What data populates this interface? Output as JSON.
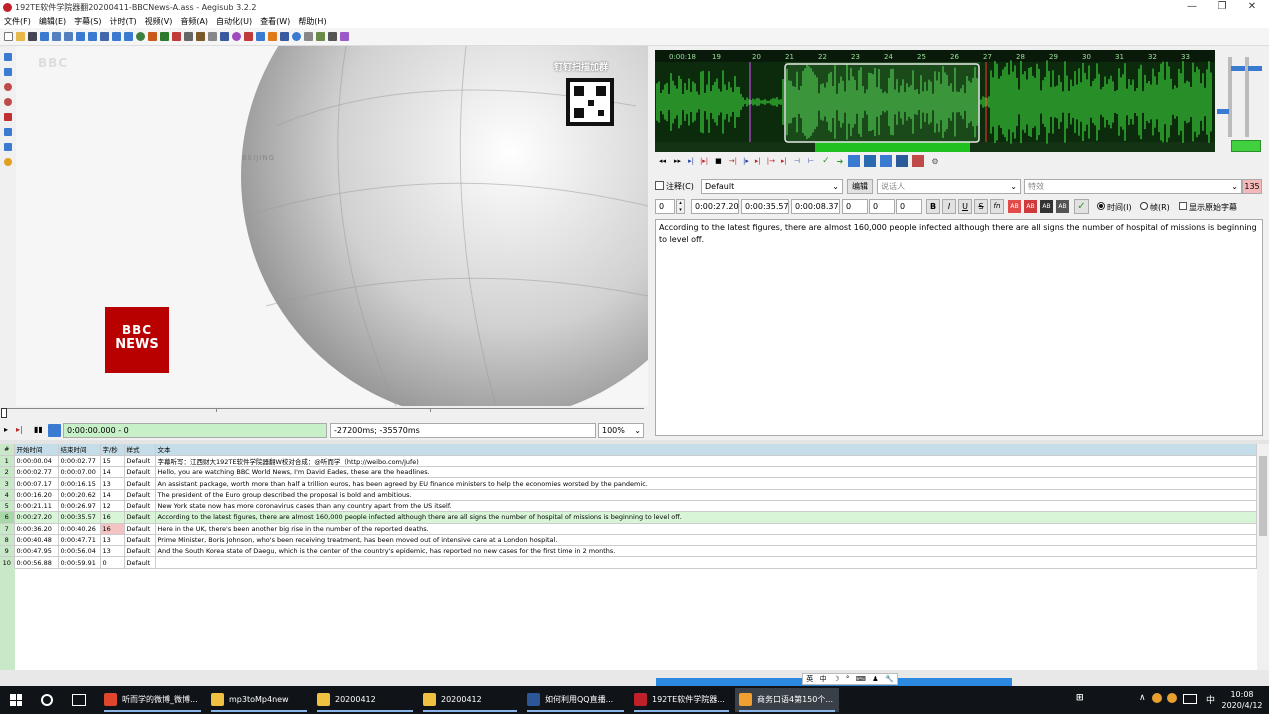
{
  "window": {
    "title": "192TE软件学院器翻20200411-BBCNews-A.ass - Aegisub 3.2.2",
    "min": "—",
    "max": "❐",
    "close": "✕"
  },
  "menu": [
    "文件(F)",
    "编辑(E)",
    "字幕(S)",
    "计时(T)",
    "视频(V)",
    "音频(A)",
    "自动化(U)",
    "查看(W)",
    "帮助(H)"
  ],
  "video": {
    "bbc_logo": "BBC",
    "bbc_news_top": "BBC",
    "bbc_news_bottom": "NEWS",
    "watermark": "钉钉扫描加群",
    "city": "BEIJING",
    "timecode": "0:00:00.000 - 0",
    "offset": "-27200ms; -35570ms",
    "zoom": "100%"
  },
  "audio": {
    "ticks": [
      "0:00:18",
      "19",
      "20",
      "21",
      "22",
      "23",
      "24",
      "25",
      "26",
      "27",
      "28",
      "29",
      "30",
      "31",
      "32",
      "33"
    ]
  },
  "edit": {
    "comment_label": "注释(C)",
    "style": "Default",
    "edit_button": "编辑",
    "actor_placeholder": "说话人",
    "effect_placeholder": "特效",
    "char_count": "135",
    "layer": "0",
    "start": "0:00:27.20",
    "end": "0:00:35.57",
    "duration": "0:00:08.37",
    "margin_l": "0",
    "margin_r": "0",
    "margin_v": "0",
    "bold": "B",
    "italic": "I",
    "underline": "U",
    "strike": "S",
    "fn": "fn",
    "time_radio": "时间(I)",
    "frame_radio": "帧(R)",
    "show_original": "显示原始字幕",
    "text": "According to the latest figures, there are almost 160,000 people infected although there are all signs the number of hospital of missions is beginning to level off."
  },
  "grid": {
    "headers": [
      "#",
      "开始时间",
      "结束时间",
      "字/秒",
      "样式",
      "文本"
    ],
    "rows": [
      {
        "n": "1",
        "start": "0:00:00.04",
        "end": "0:00:02.77",
        "cps": "15",
        "style": "Default",
        "text": "字幕听写：江西财大192TE软件学院器翻W校对合成：@听而学（http://weibo.com/jufe)"
      },
      {
        "n": "2",
        "start": "0:00:02.77",
        "end": "0:00:07.00",
        "cps": "14",
        "style": "Default",
        "text": "Hello, you are watching BBC World News, I'm David Eades, these are the headlines."
      },
      {
        "n": "3",
        "start": "0:00:07.17",
        "end": "0:00:16.15",
        "cps": "13",
        "style": "Default",
        "text": "An assistant package, worth more than half a trillion euros, has been agreed by EU finance ministers to help the economies worsted by the pandemic."
      },
      {
        "n": "4",
        "start": "0:00:16.20",
        "end": "0:00:20.62",
        "cps": "14",
        "style": "Default",
        "text": "The president of the Euro group described the proposal is bold and ambitious."
      },
      {
        "n": "5",
        "start": "0:00:21.11",
        "end": "0:00:26.97",
        "cps": "12",
        "style": "Default",
        "text": "New York state now has more coronavirus cases than any country apart from the US itself."
      },
      {
        "n": "6",
        "start": "0:00:27.20",
        "end": "0:00:35.57",
        "cps": "16",
        "style": "Default",
        "text": "According to the latest figures, there are almost 160,000 people infected although there are all signs the number of hospital of missions is beginning to level off."
      },
      {
        "n": "7",
        "start": "0:00:36.20",
        "end": "0:00:40.26",
        "cps": "16",
        "style": "Default",
        "text": "Here in the UK, there's been another big rise in the number of the reported deaths."
      },
      {
        "n": "8",
        "start": "0:00:40.48",
        "end": "0:00:47.71",
        "cps": "13",
        "style": "Default",
        "text": "Prime Minister, Boris Johnson, who's been receiving treatment, has been moved out of intensive care at a London hospital."
      },
      {
        "n": "9",
        "start": "0:00:47.95",
        "end": "0:00:56.04",
        "cps": "13",
        "style": "Default",
        "text": "And the South Korea state of Daegu, which is the center of the country's epidemic, has reported no new cases for the first time in 2 months."
      },
      {
        "n": "10",
        "start": "0:00:56.88",
        "end": "0:00:59.91",
        "cps": "0",
        "style": "Default",
        "text": ""
      }
    ]
  },
  "ime": [
    "英",
    "中",
    "☽",
    "°",
    "⌨",
    "♟",
    "🔧"
  ],
  "taskbar": {
    "items": [
      {
        "label": "听而学的微博_微博...",
        "color": "#e0452d"
      },
      {
        "label": "mp3toMp4new",
        "color": "#f0c040"
      },
      {
        "label": "20200412",
        "color": "#f0c040"
      },
      {
        "label": "20200412",
        "color": "#f0c040"
      },
      {
        "label": "如何利用QQ直播...",
        "color": "#2b5797"
      },
      {
        "label": "192TE软件学院器...",
        "color": "#c0202a"
      },
      {
        "label": "商务口语4第150个...",
        "color": "#f0a030"
      }
    ],
    "tray_lang": "中",
    "time": "10:08",
    "date": "2020/4/12"
  }
}
